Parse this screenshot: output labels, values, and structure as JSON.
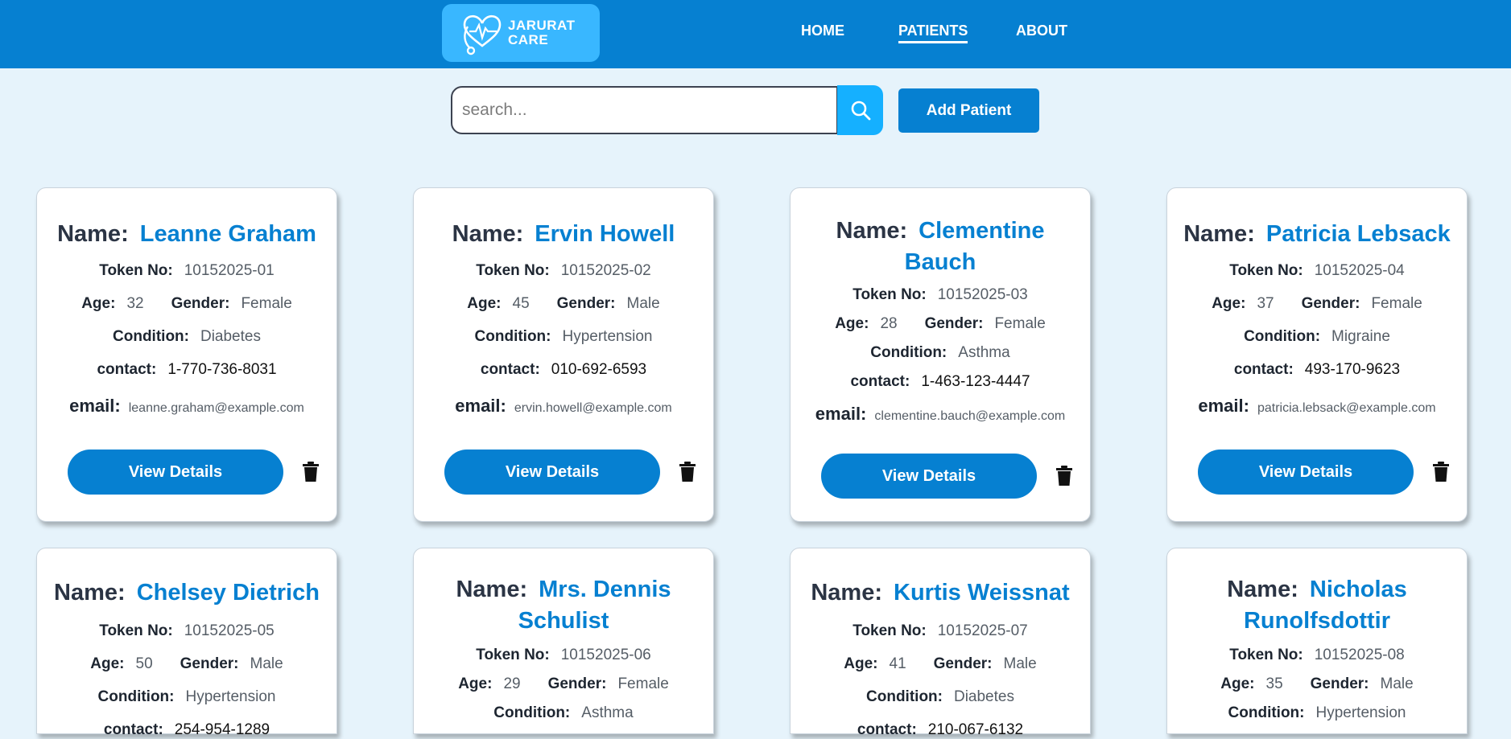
{
  "header": {
    "logo_line1": "JARURAT",
    "logo_line2": "CARE",
    "nav": [
      "HOME",
      "PATIENTS",
      "ABOUT"
    ]
  },
  "toolbar": {
    "search_placeholder": "search...",
    "add_label": "Add Patient"
  },
  "labels": {
    "name": "Name:",
    "token": "Token No:",
    "age": "Age:",
    "gender": "Gender:",
    "condition": "Condition:",
    "contact": "contact:",
    "email": "email:",
    "view": "View Details"
  },
  "patients": [
    {
      "name": "Leanne Graham",
      "token": "10152025-01",
      "age": "32",
      "gender": "Female",
      "condition": "Diabetes",
      "contact": "1-770-736-8031",
      "email": "leanne.graham@example.com"
    },
    {
      "name": "Ervin Howell",
      "token": "10152025-02",
      "age": "45",
      "gender": "Male",
      "condition": "Hypertension",
      "contact": "010-692-6593",
      "email": "ervin.howell@example.com"
    },
    {
      "name": "Clementine Bauch",
      "token": "10152025-03",
      "age": "28",
      "gender": "Female",
      "condition": "Asthma",
      "contact": "1-463-123-4447",
      "email": "clementine.bauch@example.com"
    },
    {
      "name": "Patricia Lebsack",
      "token": "10152025-04",
      "age": "37",
      "gender": "Female",
      "condition": "Migraine",
      "contact": "493-170-9623",
      "email": "patricia.lebsack@example.com"
    },
    {
      "name": "Chelsey Dietrich",
      "token": "10152025-05",
      "age": "50",
      "gender": "Male",
      "condition": "Hypertension",
      "contact": "254-954-1289",
      "email": ""
    },
    {
      "name": "Mrs. Dennis Schulist",
      "token": "10152025-06",
      "age": "29",
      "gender": "Female",
      "condition": "Asthma",
      "contact": "",
      "email": ""
    },
    {
      "name": "Kurtis Weissnat",
      "token": "10152025-07",
      "age": "41",
      "gender": "Male",
      "condition": "Diabetes",
      "contact": "210-067-6132",
      "email": ""
    },
    {
      "name": "Nicholas Runolfsdottir",
      "token": "10152025-08",
      "age": "35",
      "gender": "Male",
      "condition": "Hypertension",
      "contact": "",
      "email": ""
    }
  ]
}
